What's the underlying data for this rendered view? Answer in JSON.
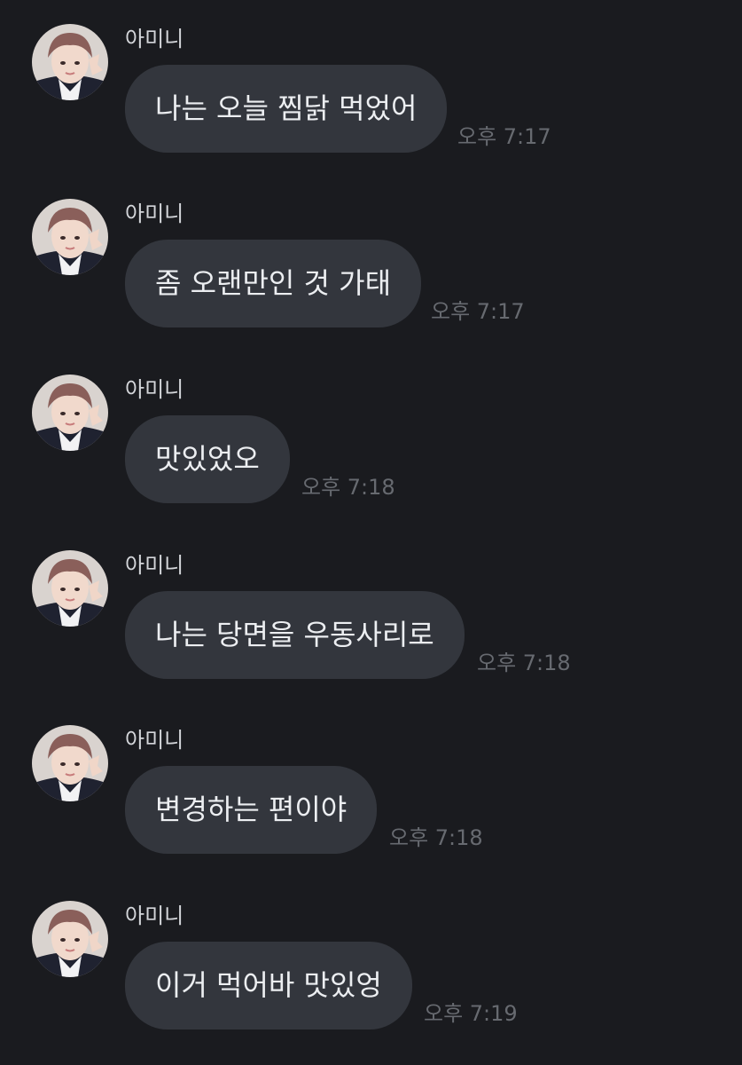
{
  "messages": [
    {
      "sender": "아미니",
      "text": "나는 오늘 찜닭 먹었어",
      "time": "오후 7:17"
    },
    {
      "sender": "아미니",
      "text": "좀 오랜만인 것 가태",
      "time": "오후 7:17"
    },
    {
      "sender": "아미니",
      "text": "맛있었오",
      "time": "오후 7:18"
    },
    {
      "sender": "아미니",
      "text": "나는 당면을 우동사리로",
      "time": "오후 7:18"
    },
    {
      "sender": "아미니",
      "text": "변경하는 편이야",
      "time": "오후 7:18"
    },
    {
      "sender": "아미니",
      "text": "이거 먹어바 맛있엉",
      "time": "오후 7:19"
    }
  ],
  "avatar_icon": "profile-photo",
  "colors": {
    "background": "#1a1b1f",
    "bubble": "#33363d",
    "text": "#eceef1",
    "time": "#676a70"
  }
}
